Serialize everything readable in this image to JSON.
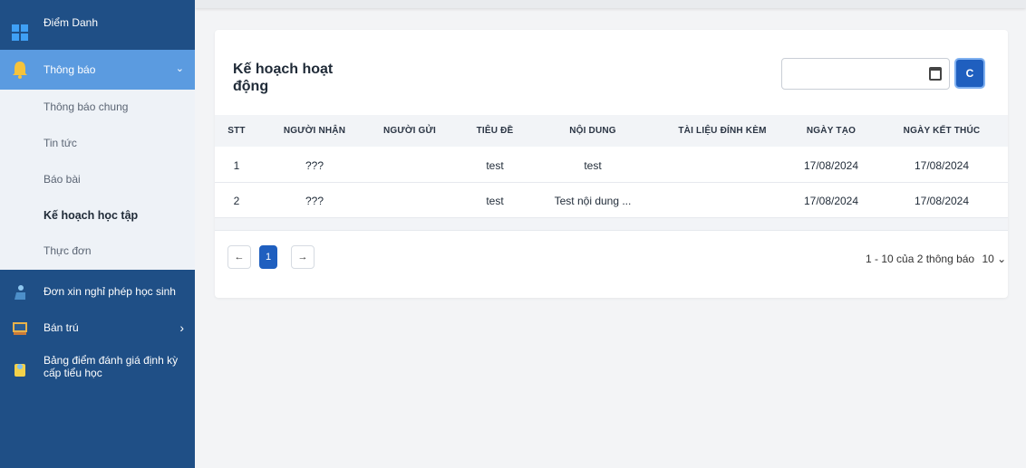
{
  "sidebar": {
    "items": [
      {
        "label": "Điểm Danh",
        "icon": "grid-icon"
      },
      {
        "label": "Thông báo",
        "icon": "bell-icon",
        "chevron": "⌄"
      },
      {
        "label": "Đơn xin nghỉ phép học sinh",
        "icon": "student-icon"
      },
      {
        "label": "Bán trú",
        "icon": "classroom-icon",
        "chevron": "›"
      },
      {
        "label": "Bảng điểm đánh giá định kỳ cấp tiểu học",
        "icon": "report-icon"
      }
    ],
    "subitems": [
      {
        "label": "Thông báo chung"
      },
      {
        "label": "Tin tức"
      },
      {
        "label": "Báo bài"
      },
      {
        "label": "Kế hoạch học tập"
      },
      {
        "label": "Thực đơn"
      }
    ]
  },
  "main": {
    "title": "Kế hoạch hoạt động",
    "date_filter": {
      "value": "",
      "placeholder": ""
    },
    "refresh_icon": "C",
    "table": {
      "headers": [
        "STT",
        "NGƯỜI NHẬN",
        "NGƯỜI GỬI",
        "TIÊU ĐỀ",
        "NỘI DUNG",
        "TÀI LIỆU ĐÍNH KÈM",
        "NGÀY TẠO",
        "NGÀY KẾT THÚC"
      ],
      "rows": [
        [
          "1",
          "???",
          "",
          "test",
          "test",
          "",
          "17/08/2024",
          "17/08/2024"
        ],
        [
          "2",
          "???",
          "",
          "test",
          "Test nội dung ...",
          "",
          "17/08/2024",
          "17/08/2024"
        ]
      ]
    },
    "pagination": {
      "prev": "←",
      "current": "1",
      "next": "→",
      "info": "1 - 10 của 2 thông báo",
      "page_size": "10 ⌄"
    }
  },
  "colors": {
    "sidebar": "#1f4f86",
    "active": "#5b9be0",
    "primary": "#1f5fbf"
  }
}
